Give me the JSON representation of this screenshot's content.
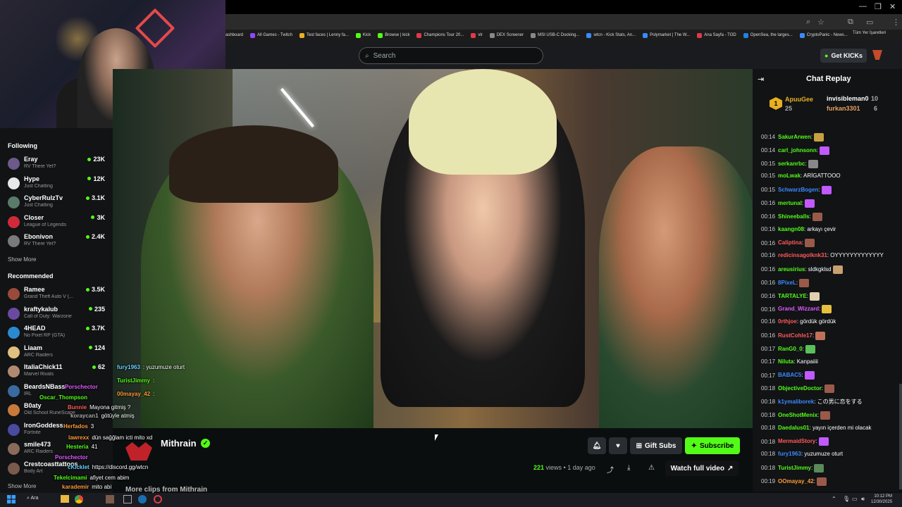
{
  "bookmarks": [
    "ashboard",
    "All Games - Twitch",
    "Test faces | Lenny fa...",
    "Kick",
    "Browse | kick",
    "Champions Tour 20...",
    "vlr",
    "DEX Screener",
    "MSI USB-C Docking...",
    "wtcn - Kick Stats, An...",
    "Polymarket | The W...",
    "Ana Sayfa - TOD",
    "OpenSea, the larges...",
    "CryptoPanic - News..."
  ],
  "bookmarks_right": "Tüm Yer İşaretleri",
  "search": {
    "placeholder": "Search"
  },
  "get_kicks": "Get KICKs",
  "sidebar": {
    "following_title": "Following",
    "following": [
      {
        "name": "Eray",
        "game": "RV There Yet?",
        "viewers": "23K",
        "color": "#6b5a8a"
      },
      {
        "name": "Hype",
        "game": "Just Chatting",
        "viewers": "12K",
        "color": "#e8e8e8"
      },
      {
        "name": "CyberRulzTv",
        "game": "Just Chatting",
        "viewers": "3.1K",
        "color": "#5a7a6a"
      },
      {
        "name": "Closer",
        "game": "League of Legends",
        "viewers": "3K",
        "color": "#d02a3a"
      },
      {
        "name": "Ebonivon",
        "game": "RV There Yet?",
        "viewers": "2.4K",
        "color": "#7a7a7a"
      }
    ],
    "show_more_1": "Show More",
    "recommended_title": "Recommended",
    "recommended": [
      {
        "name": "Ramee",
        "game": "Grand Theft Auto V (...",
        "viewers": "3.5K",
        "color": "#9a4a3a"
      },
      {
        "name": "kraftykalub",
        "game": "Call of Duty: Warzone",
        "viewers": "235",
        "color": "#6a4aa0"
      },
      {
        "name": "4HEAD",
        "game": "No Pixel RP (GTA)",
        "viewers": "3.7K",
        "color": "#2a8ad0"
      },
      {
        "name": "Liaam",
        "game": "ARC Raiders",
        "viewers": "124",
        "color": "#e0c080"
      },
      {
        "name": "ItaliaChick11",
        "game": "Marvel Rivals",
        "viewers": "62",
        "color": "#b08a70"
      },
      {
        "name": "BeardsNBass",
        "game": "IRL",
        "viewers": "",
        "color": "#3a6aa0"
      },
      {
        "name": "B0aty",
        "game": "Old School RuneScape",
        "viewers": "",
        "color": "#c87a3a"
      },
      {
        "name": "IronGoddess",
        "game": "Fortnite",
        "viewers": "",
        "color": "#4a4aa0"
      },
      {
        "name": "smile473",
        "game": "ARC Raiders",
        "viewers": "",
        "color": "#8a6a5a"
      },
      {
        "name": "Crestcoasttattoos",
        "game": "Body Art",
        "viewers": "",
        "color": "#7a5a4a"
      }
    ],
    "show_more_2": "Show More"
  },
  "overlay_chat": [
    {
      "user": "fury1963",
      "text": ": yuzumuze oturt",
      "color": "#6ad0ff"
    },
    {
      "user": "TuristJimmy",
      "text": ":",
      "color": "#53fc18"
    },
    {
      "user": "00mayay_42",
      "text": ":",
      "color": "#ff9a3a"
    },
    {
      "user": "Porschector",
      "text": "",
      "color": "#e05aff"
    },
    {
      "user": "Oscar_Thompson",
      "text": "",
      "color": "#53fc18"
    },
    {
      "user": "Bunnie",
      "text": "Mayona gitmiş ?",
      "color": "#ff5a5a"
    },
    {
      "user": "koraycan1",
      "text": "götüyle atmiş",
      "color": "#aaaaaa"
    },
    {
      "user": "Herfados",
      "text": "3",
      "color": "#ff9a3a"
    },
    {
      "user": "lawrexx",
      "text": "dün sağğlam icti mito xd",
      "color": "#ff9a3a"
    },
    {
      "user": "Hesteria",
      "text": "41",
      "color": "#53fc18"
    },
    {
      "user": "Porschector",
      "text": "",
      "color": "#e05aff"
    },
    {
      "user": "cKicklet",
      "text": "https://discord.gg/wtcn",
      "color": "#6ad0ff"
    },
    {
      "user": "Tekelcimami",
      "text": "afiyet cem abim",
      "color": "#53fc18"
    },
    {
      "user": "karademir",
      "text": "mito abi",
      "color": "#ff9a3a"
    }
  ],
  "stream": {
    "channel": "Mithrain",
    "views": "221",
    "views_label": "views",
    "age": "1 day ago",
    "gift_subs": "Gift Subs",
    "subscribe": "Subscribe",
    "watch_full": "Watch full video",
    "more_clips": "More clips from Mithrain"
  },
  "chat": {
    "title": "Chat Replay",
    "pinned": [
      {
        "name": "ApuuGee",
        "count": "25"
      },
      {
        "name": "invisibleman0",
        "count": "10"
      },
      {
        "name": "furkan3301",
        "count": "6"
      }
    ],
    "messages": [
      {
        "time": "00:14",
        "user": "SakurArwen",
        "text": ":",
        "color": "#53fc18",
        "emote": "#c8a040"
      },
      {
        "time": "00:14",
        "user": "carl_johnsonn",
        "text": ":",
        "color": "#53fc18",
        "emote": "#c05aff"
      },
      {
        "time": "00:15",
        "user": "serkanrbc",
        "text": ":",
        "color": "#53fc18",
        "emote": "#888888"
      },
      {
        "time": "00:15",
        "user": "moLwak",
        "text": ": ARİGATTOOO",
        "color": "#53fc18",
        "emote": ""
      },
      {
        "time": "00:15",
        "user": "SchwarzBogen",
        "text": ":",
        "color": "#3a8aff",
        "emote": "#c05aff"
      },
      {
        "time": "00:16",
        "user": "mertunal",
        "text": ":",
        "color": "#53fc18",
        "emote": "#c05aff"
      },
      {
        "time": "00:16",
        "user": "Shineeballs",
        "text": ":",
        "color": "#53fc18",
        "emote": "#9a5a4a"
      },
      {
        "time": "00:16",
        "user": "kaangn08",
        "text": ": arkayı çevir",
        "color": "#53fc18",
        "emote": ""
      },
      {
        "time": "00:16",
        "user": "Caliptina",
        "text": ":",
        "color": "#ff5a5a",
        "emote": "#9a5a4a"
      },
      {
        "time": "00:16",
        "user": "redicinsagolknk31",
        "text": ": OYYYYYYYYYYYYY",
        "color": "#ff5a5a",
        "emote": ""
      },
      {
        "time": "00:16",
        "user": "areusirius",
        "text": ": sldkgklsd",
        "color": "#53fc18",
        "emote": "#c8a070"
      },
      {
        "time": "00:16",
        "user": "8PixeL",
        "text": ":",
        "color": "#3a8aff",
        "emote": "#9a5a4a"
      },
      {
        "time": "00:16",
        "user": "TARTALYE",
        "text": ":",
        "color": "#53fc18",
        "emote": "#e0d0b0"
      },
      {
        "time": "00:16",
        "user": "Grand_Wizzard",
        "text": ":",
        "color": "#e05aff",
        "emote": "#e8c040"
      },
      {
        "time": "00:16",
        "user": "0rthjoe",
        "text": ": gördük gördük",
        "color": "#ff5a5a",
        "emote": ""
      },
      {
        "time": "00:16",
        "user": "RustCohle17",
        "text": ":",
        "color": "#ff5a5a",
        "emote": "#c0705a"
      },
      {
        "time": "00:17",
        "user": "RanG0_0",
        "text": ":",
        "color": "#53fc18",
        "emote": "#5ac05a"
      },
      {
        "time": "00:17",
        "user": "Niluta",
        "text": ": Kanpaiiii",
        "color": "#53fc18",
        "emote": ""
      },
      {
        "time": "00:17",
        "user": "BABAC5",
        "text": ":",
        "color": "#3a8aff",
        "emote": "#c05aff"
      },
      {
        "time": "00:18",
        "user": "ObjectiveDoctor",
        "text": ":",
        "color": "#53fc18",
        "emote": "#9a5a4a"
      },
      {
        "time": "00:18",
        "user": "k1ymaliborek",
        "text": ": この男に恋をする",
        "color": "#3a8aff",
        "emote": ""
      },
      {
        "time": "00:18",
        "user": "OneShotMenix",
        "text": ":",
        "color": "#53fc18",
        "emote": "#9a5a4a"
      },
      {
        "time": "00:18",
        "user": "Daedalus01",
        "text": ": yayın içerden mi olacak",
        "color": "#53fc18",
        "emote": ""
      },
      {
        "time": "00:18",
        "user": "MermaidStory",
        "text": ":",
        "color": "#ff5a5a",
        "emote": "#c05aff"
      },
      {
        "time": "00:18",
        "user": "fury1963",
        "text": ": yuzumuze oturt",
        "color": "#3a8aff",
        "emote": ""
      },
      {
        "time": "00:18",
        "user": "TuristJimmy",
        "text": ":",
        "color": "#53fc18",
        "emote": "#5a8a5a"
      },
      {
        "time": "00:19",
        "user": "OOmayay_42",
        "text": ":",
        "color": "#ff9a3a",
        "emote": "#9a5a4a"
      }
    ]
  },
  "taskbar": {
    "search": "Ara",
    "time": "10:12 PM",
    "date": "12/30/2025"
  },
  "colors": {
    "accent": "#53fc18",
    "brand_red": "#c0222a"
  }
}
